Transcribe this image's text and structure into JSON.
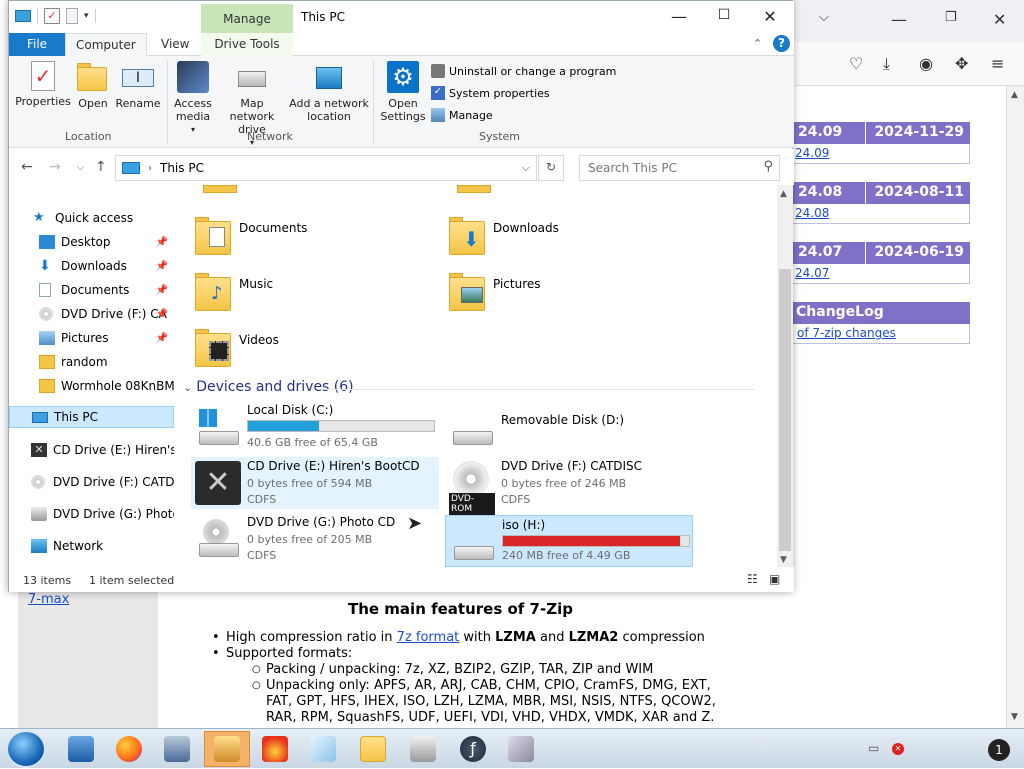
{
  "explorer": {
    "title": "This PC",
    "contextual_tab_group": "Manage",
    "tabs": [
      "File",
      "Computer",
      "View",
      "Drive Tools"
    ],
    "ribbon": {
      "location": {
        "label": "Location",
        "buttons": [
          "Properties",
          "Open",
          "Rename"
        ]
      },
      "network": {
        "label": "Network",
        "buttons": [
          "Access media",
          "Map network drive",
          "Add a network location"
        ]
      },
      "system": {
        "label": "System",
        "open_settings": "Open Settings",
        "items": [
          "Uninstall or change a program",
          "System properties",
          "Manage"
        ]
      }
    },
    "address": {
      "path": "This PC",
      "search_placeholder": "Search This PC"
    },
    "nav": {
      "quick_access": "Quick access",
      "pinned": [
        "Desktop",
        "Downloads",
        "Documents",
        "DVD Drive (F:) CA",
        "Pictures",
        "random",
        "Wormhole 08KnBM"
      ],
      "this_pc": "This PC",
      "drives": [
        "CD Drive (E:) Hiren's B",
        "DVD Drive (F:) CATDIS",
        "DVD Drive (G:) Photo",
        "Network"
      ]
    },
    "folders": [
      "Documents",
      "Downloads",
      "Music",
      "Pictures",
      "Videos"
    ],
    "devices_header": "Devices and drives (6)",
    "devices": [
      {
        "name": "Local Disk (C:)",
        "free": "40.6 GB free of 65.4 GB",
        "used_fraction": 0.38,
        "bar_color": "#26a0da"
      },
      {
        "name": "Removable Disk (D:)"
      },
      {
        "name": "CD Drive (E:) Hiren's BootCD",
        "free": "0 bytes free of 594 MB",
        "fs": "CDFS"
      },
      {
        "name": "DVD Drive (F:) CATDISC",
        "free": "0 bytes free of 246 MB",
        "fs": "CDFS",
        "badge": "DVD-ROM"
      },
      {
        "name": "DVD Drive (G:) Photo CD",
        "free": "0 bytes free of 205 MB",
        "fs": "CDFS"
      },
      {
        "name": "iso (H:)",
        "free": "240 MB free of 4.49 GB",
        "used_fraction": 0.95,
        "bar_color": "#da2626"
      }
    ],
    "status": {
      "items": "13 items",
      "selected": "1 item selected"
    }
  },
  "browser": {
    "releases": [
      {
        "ver": "24.09",
        "date": "2024-11-29",
        "link": "24.09"
      },
      {
        "ver": "24.08",
        "date": "2024-08-11",
        "link": "24.08"
      },
      {
        "ver": "24.07",
        "date": "2024-06-19",
        "link": "24.07"
      }
    ],
    "changelog": {
      "title": "ChangeLog",
      "link": "of 7-zip changes"
    },
    "sidebar_link": "7-max",
    "features_title": "The main features of 7-Zip",
    "features": {
      "b1_pre": "High compression ratio in ",
      "b1_link": "7z format",
      "b1_mid": " with ",
      "b1_lzma": "LZMA",
      "b1_and": " and ",
      "b1_lzma2": "LZMA2",
      "b1_post": " compression",
      "b2": "Supported formats:",
      "s1": "Packing / unpacking: 7z, XZ, BZIP2, GZIP, TAR, ZIP and WIM",
      "s2a": "Unpacking only: APFS, AR, ARJ, CAB, CHM, CPIO, CramFS, DMG, EXT,",
      "s2b": "FAT, GPT, HFS, IHEX, ISO, LZH, LZMA, MBR, MSI, NSIS, NTFS, QCOW2,",
      "s2c": "RAR, RPM, SquashFS, UDF, UEFI, VDI, VHD, VHDX, VMDK, XAR and Z."
    }
  },
  "tray": {
    "notification_count": "1"
  }
}
